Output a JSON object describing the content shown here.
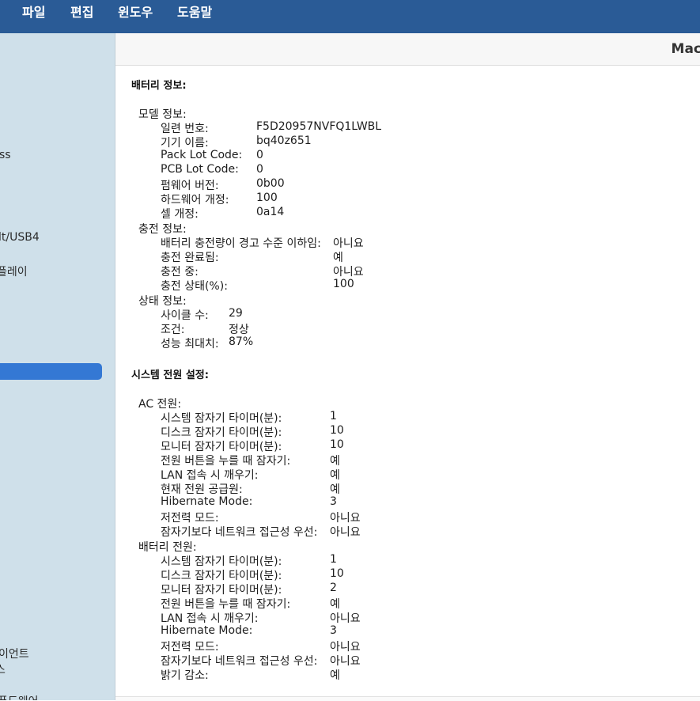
{
  "menubar": {
    "items": [
      "파일",
      "편집",
      "윈도우",
      "도움말"
    ]
  },
  "window": {
    "title": "Mac"
  },
  "sidebar": {
    "fragments": [
      "ss",
      "lt/USB4",
      "플레이",
      "이언트",
      "스",
      "퓨드웨어"
    ]
  },
  "battery": {
    "title": "배터리 정보:",
    "model": {
      "label": "모델 정보:",
      "rows": [
        {
          "k": "일련 번호:",
          "v": "F5D20957NVFQ1LWBL"
        },
        {
          "k": "기기 이름:",
          "v": "bq40z651"
        },
        {
          "k": "Pack Lot Code:",
          "v": "0"
        },
        {
          "k": "PCB Lot Code:",
          "v": "0"
        },
        {
          "k": "펌웨어 버전:",
          "v": "0b00"
        },
        {
          "k": "하드웨어 개정:",
          "v": "100"
        },
        {
          "k": "셀 개정:",
          "v": "0a14"
        }
      ]
    },
    "charge": {
      "label": "충전 정보:",
      "rows": [
        {
          "k": "배터리 충전량이 경고 수준 이하임:",
          "v": "아니요"
        },
        {
          "k": "충전 완료됨:",
          "v": "예"
        },
        {
          "k": "충전 중:",
          "v": "아니요"
        },
        {
          "k": "충전 상태(%):",
          "v": "100"
        }
      ]
    },
    "health": {
      "label": "상태 정보:",
      "rows": [
        {
          "k": "사이클 수:",
          "v": "29"
        },
        {
          "k": "조건:",
          "v": "정상"
        },
        {
          "k": "성능 최대치:",
          "v": "87%"
        }
      ]
    }
  },
  "power": {
    "title": "시스템 전원 설정:",
    "ac": {
      "label": "AC 전원:",
      "rows": [
        {
          "k": "시스템 잠자기 타이머(분):",
          "v": "1"
        },
        {
          "k": "디스크 잠자기 타이머(분):",
          "v": "10"
        },
        {
          "k": "모니터 잠자기 타이머(분):",
          "v": "10"
        },
        {
          "k": "전원 버튼을 누를 때 잠자기:",
          "v": "예"
        },
        {
          "k": "LAN 접속 시 깨우기:",
          "v": "예"
        },
        {
          "k": "현재 전원 공급원:",
          "v": "예"
        },
        {
          "k": "Hibernate Mode:",
          "v": "3"
        },
        {
          "k": "저전력 모드:",
          "v": "아니요"
        },
        {
          "k": "잠자기보다 네트워크 접근성 우선:",
          "v": "아니요"
        }
      ]
    },
    "battery_power": {
      "label": "배터리 전원:",
      "rows": [
        {
          "k": "시스템 잠자기 타이머(분):",
          "v": "1"
        },
        {
          "k": "디스크 잠자기 타이머(분):",
          "v": "10"
        },
        {
          "k": "모니터 잠자기 타이머(분):",
          "v": "2"
        },
        {
          "k": "전원 버튼을 누를 때 잠자기:",
          "v": "예"
        },
        {
          "k": "LAN 접속 시 깨우기:",
          "v": "아니요"
        },
        {
          "k": "Hibernate Mode:",
          "v": "3"
        },
        {
          "k": "저전력 모드:",
          "v": "아니요"
        },
        {
          "k": "잠자기보다 네트워크 접근성 우선:",
          "v": "아니요"
        },
        {
          "k": "밝기 감소:",
          "v": "예"
        }
      ]
    }
  },
  "colors": {
    "menubar": "#2a5b96",
    "sidebar": "#cfe0ea",
    "selection": "#3478d4"
  }
}
